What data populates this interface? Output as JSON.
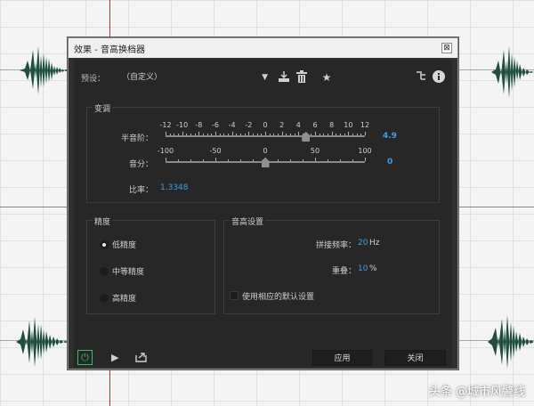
{
  "dialog": {
    "title": "效果 - 音高换档器",
    "close_glyph": "⊠"
  },
  "preset": {
    "label": "预设：",
    "value": "（自定义）",
    "icons": [
      "download-icon",
      "trash-icon",
      "star-icon",
      "routing-icon",
      "info-icon"
    ]
  },
  "pitch_group": {
    "title": "变调",
    "semitone": {
      "label": "半音阶：",
      "scale": [
        "-12",
        "-10",
        "-8",
        "-6",
        "-4",
        "-2",
        "0",
        "2",
        "4",
        "6",
        "8",
        "10",
        "12"
      ],
      "value": "4.9",
      "value_num": 4.9,
      "min": -12,
      "max": 12
    },
    "cents": {
      "label": "音分：",
      "scale": [
        "-100",
        "-50",
        "0",
        "50",
        "100"
      ],
      "value": "0",
      "value_num": 0,
      "min": -100,
      "max": 100
    },
    "ratio": {
      "label": "比率：",
      "value": "1.3348"
    }
  },
  "precision_group": {
    "title": "精度",
    "options": [
      {
        "label": "低精度",
        "selected": true
      },
      {
        "label": "中等精度",
        "selected": false
      },
      {
        "label": "高精度",
        "selected": false
      }
    ]
  },
  "pitch_settings": {
    "title": "音高设置",
    "splice_freq": {
      "label": "拼接频率：",
      "value": "20",
      "unit": "Hz"
    },
    "overlap": {
      "label": "重叠：",
      "value": "10",
      "unit": "%"
    },
    "use_default": {
      "label": "使用相应的默认设置",
      "checked": false
    }
  },
  "footer": {
    "apply": "应用",
    "close": "关闭"
  },
  "watermark": "头条 @城市风警线",
  "colors": {
    "accent": "#3aa0e6",
    "power": "#2fbf6a",
    "playhead": "#d03030"
  }
}
